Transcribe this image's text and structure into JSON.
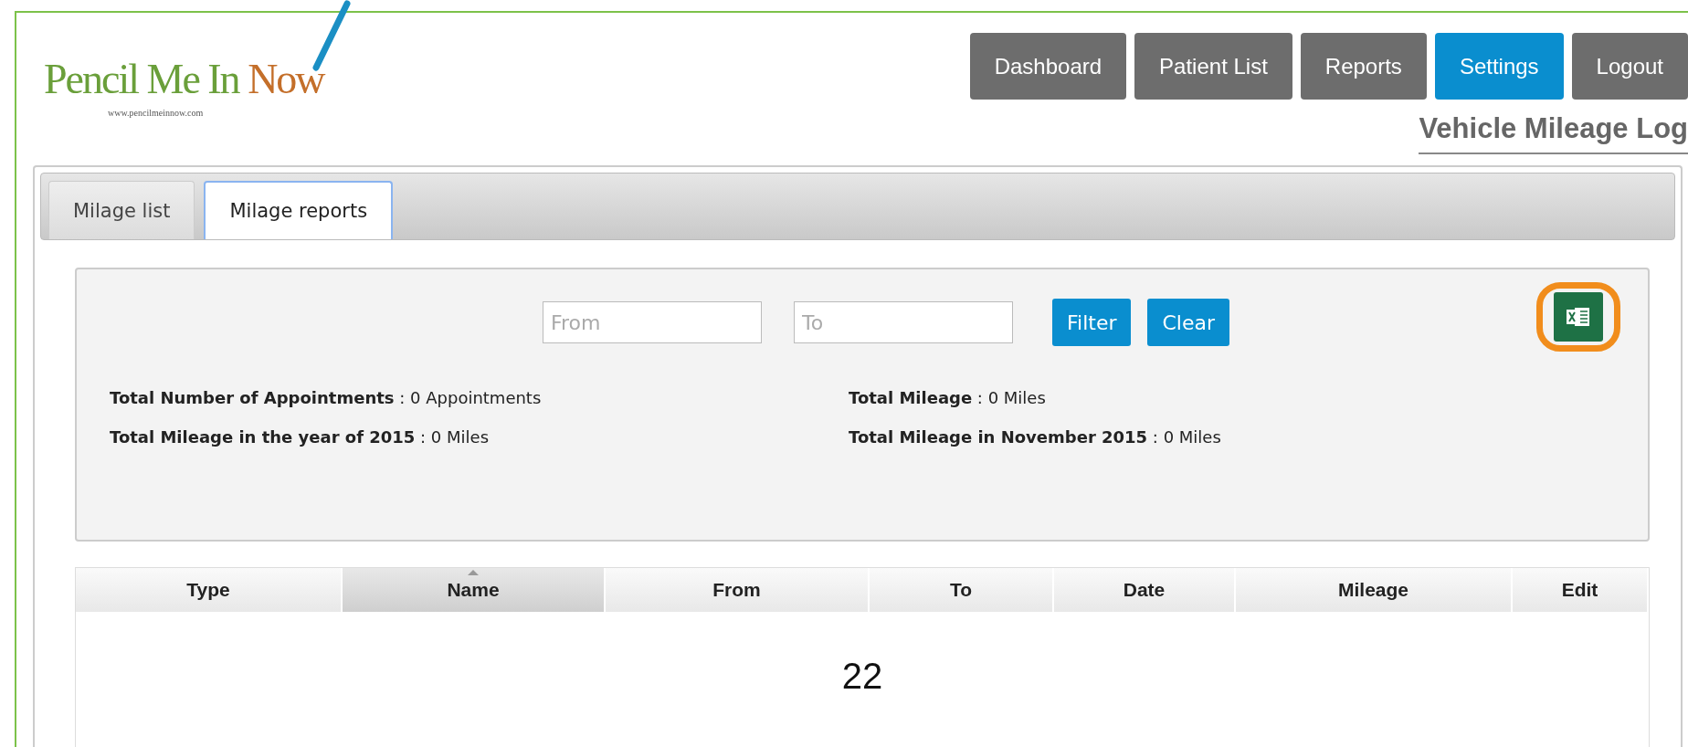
{
  "logo": {
    "brand_primary": "Pencil Me In",
    "brand_accent": "Now",
    "url": "www.pencilmeinnow.com"
  },
  "nav": [
    {
      "label": "Dashboard",
      "selected": false
    },
    {
      "label": "Patient List",
      "selected": false
    },
    {
      "label": "Reports",
      "selected": false
    },
    {
      "label": "Settings",
      "selected": true
    },
    {
      "label": "Logout",
      "selected": false
    }
  ],
  "page_title": "Vehicle Mileage Log",
  "tabs": [
    {
      "label": "Milage list",
      "selected": false
    },
    {
      "label": "Milage reports",
      "selected": true
    }
  ],
  "filter": {
    "fields": [
      {
        "placeholder": "From"
      },
      {
        "placeholder": "To"
      }
    ],
    "buttons": [
      "Filter",
      "Clear"
    ],
    "export": {
      "highlighted": true
    }
  },
  "stats": [
    "**Total Number of Appointments** : 0 Appointments",
    "**Total Mileage** : 0 Miles",
    "**Total Mileage in the year of 2015** : 0 Miles",
    "**Total Mileage in November 2015** : 0 Miles"
  ],
  "table": {
    "columns": [
      {
        "label": "Type",
        "sorted": false
      },
      {
        "label": "Name",
        "sorted": true
      },
      {
        "label": "From",
        "sorted": false
      },
      {
        "label": "To",
        "sorted": false
      },
      {
        "label": "Date",
        "sorted": false
      },
      {
        "label": "Mileage",
        "sorted": false
      },
      {
        "label": "Edit",
        "sorted": false
      }
    ]
  },
  "page_number": "22"
}
